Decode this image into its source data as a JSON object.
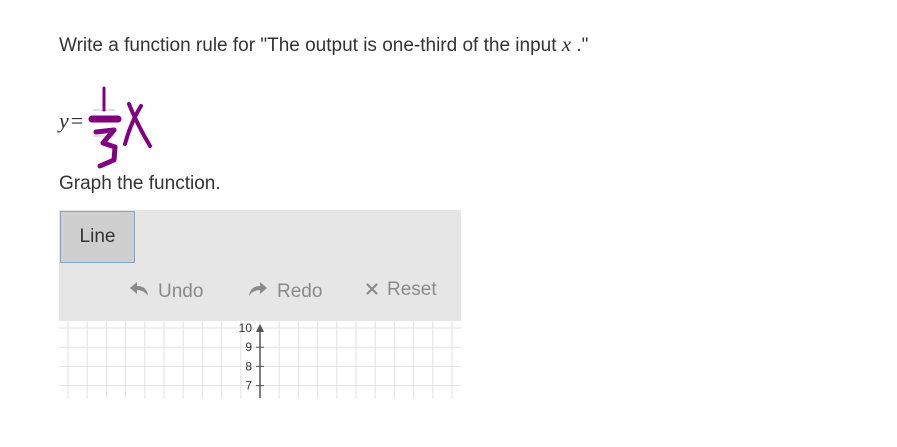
{
  "question": {
    "prefix": "Write a function rule for \"The output is one-third of the input ",
    "variable": "x",
    "suffix": " .\""
  },
  "answer": {
    "variable": "y",
    "equals": "=",
    "handwritten_input": "1/3 x",
    "ink_color": "#800080"
  },
  "instruction": "Graph the function.",
  "graph": {
    "tool_label": "Line",
    "actions": {
      "undo": "Undo",
      "redo": "Redo",
      "reset": "Reset"
    },
    "icons": {
      "undo": "undo-arrow-icon",
      "redo": "redo-arrow-icon",
      "reset": "close-x-icon"
    },
    "y_axis_ticks": [
      "10",
      "9",
      "8",
      "7"
    ],
    "colors": {
      "toolbar_bg": "#e6e6e6",
      "tool_active_bg": "#cfcfcf",
      "tool_border": "#7ea6cf",
      "grid_line": "#e2e2e2",
      "axis": "#555555"
    }
  }
}
